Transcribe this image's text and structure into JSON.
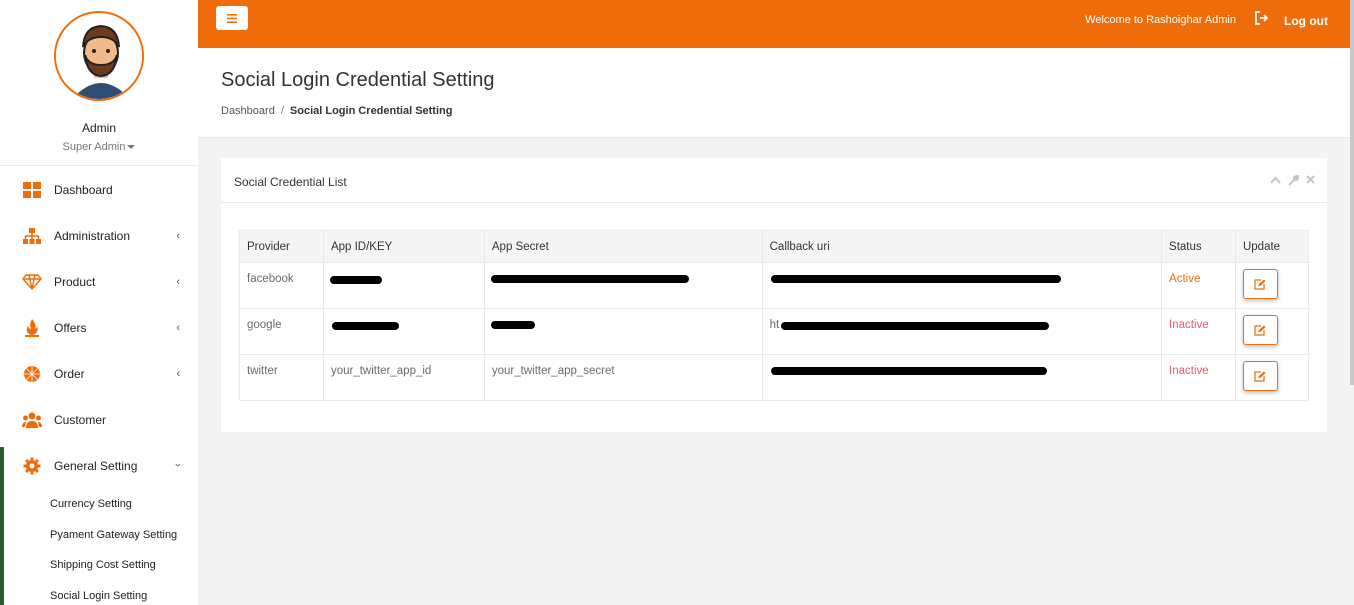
{
  "profile": {
    "name": "Admin",
    "role": "Super Admin"
  },
  "sidebar": {
    "items": [
      {
        "label": "Dashboard"
      },
      {
        "label": "Administration"
      },
      {
        "label": "Product"
      },
      {
        "label": "Offers"
      },
      {
        "label": "Order"
      },
      {
        "label": "Customer"
      },
      {
        "label": "General Setting"
      }
    ],
    "sub_items": [
      {
        "label": "Currency Setting"
      },
      {
        "label": "Pyament Gateway Setting"
      },
      {
        "label": "Shipping Cost Setting"
      },
      {
        "label": "Social Login Setting"
      }
    ]
  },
  "topbar": {
    "welcome": "Welcome to Rashoighar Admin",
    "logout": "Log out"
  },
  "page": {
    "title": "Social Login Credential Setting",
    "breadcrumb": {
      "home": "Dashboard",
      "current": "Social Login Credential Setting"
    }
  },
  "card": {
    "title": "Social Credential List",
    "columns": [
      "Provider",
      "App ID/KEY",
      "App Secret",
      "Callback uri",
      "Status",
      "Update"
    ],
    "rows": [
      {
        "provider": "facebook",
        "app_id": "",
        "app_secret": "",
        "callback": "",
        "status": "Active"
      },
      {
        "provider": "google",
        "app_id": "",
        "app_secret": "",
        "callback": "ht",
        "status": "Inactive"
      },
      {
        "provider": "twitter",
        "app_id": "your_twitter_app_id",
        "app_secret": "your_twitter_app_secret",
        "callback": "",
        "status": "Inactive"
      }
    ]
  },
  "colors": {
    "accent": "#ef6c0b",
    "inactive": "#e35d6a",
    "sidebar_active": "#2f5d2f"
  }
}
